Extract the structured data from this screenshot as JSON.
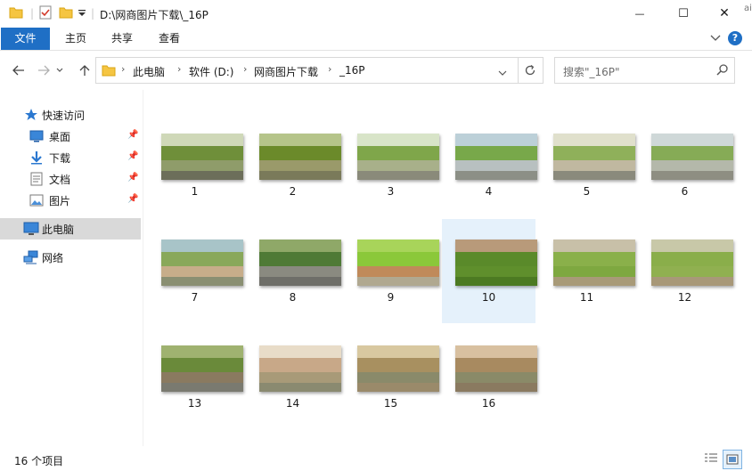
{
  "window": {
    "title": "D:\\网商图片下载\\_16P",
    "controls": {
      "minimize": "—",
      "maximize": "☐",
      "close": "✕"
    },
    "edge_text": "ai"
  },
  "ribbon": {
    "tabs": [
      {
        "label": "文件",
        "active": true
      },
      {
        "label": "主页"
      },
      {
        "label": "共享"
      },
      {
        "label": "查看"
      }
    ]
  },
  "address": {
    "crumbs": [
      "此电脑",
      "软件 (D:)",
      "网商图片下载",
      "_16P"
    ]
  },
  "search": {
    "placeholder": "搜索\"_16P\""
  },
  "sidebar": {
    "quick_access": "快速访问",
    "pinned": [
      {
        "label": "桌面",
        "icon": "desktop-icon"
      },
      {
        "label": "下载",
        "icon": "download-icon"
      },
      {
        "label": "文档",
        "icon": "document-icon"
      },
      {
        "label": "图片",
        "icon": "pictures-icon"
      }
    ],
    "this_pc": "此电脑",
    "network": "网络"
  },
  "files": [
    {
      "name": "1",
      "sky": "#cfd8b8",
      "top": "#6f8f3a",
      "mid": "#8f9c6a",
      "bottom": "#6c6e5a"
    },
    {
      "name": "2",
      "sky": "#b5c48a",
      "top": "#6b8a2a",
      "mid": "#9a9a6a",
      "bottom": "#7a7a5a"
    },
    {
      "name": "3",
      "sky": "#d8e4c8",
      "top": "#7fa64a",
      "mid": "#a8b08a",
      "bottom": "#8a8a7a"
    },
    {
      "name": "4",
      "sky": "#bcd0d8",
      "top": "#78a84a",
      "mid": "#b8c0c0",
      "bottom": "#8c8f86"
    },
    {
      "name": "5",
      "sky": "#e0e0cc",
      "top": "#8fb05a",
      "mid": "#c0b8a0",
      "bottom": "#8a8a7c"
    },
    {
      "name": "6",
      "sky": "#cfd8d8",
      "top": "#86ab56",
      "mid": "#b4b8aa",
      "bottom": "#8e8e82"
    },
    {
      "name": "7",
      "sky": "#a8c4c8",
      "top": "#89a85a",
      "mid": "#c7ad8a",
      "bottom": "#8a8f72"
    },
    {
      "name": "8",
      "sky": "#8fa868",
      "top": "#4f7a36",
      "mid": "#8a8a80",
      "bottom": "#6e6e68"
    },
    {
      "name": "9",
      "sky": "#a8d45a",
      "top": "#8bc83a",
      "mid": "#c08a5a",
      "bottom": "#b0a890"
    },
    {
      "name": "10",
      "sky": "#b89a7a",
      "top": "#5a8a2a",
      "mid": "#5f8f2c",
      "bottom": "#4c7a22"
    },
    {
      "name": "11",
      "sky": "#c8c0a8",
      "top": "#8ab04a",
      "mid": "#7ea840",
      "bottom": "#a89a78"
    },
    {
      "name": "12",
      "sky": "#c8c8a8",
      "top": "#8aae4a",
      "mid": "#90b050",
      "bottom": "#a89878"
    },
    {
      "name": "13",
      "sky": "#9fb270",
      "top": "#6a8a3a",
      "mid": "#8a7a60",
      "bottom": "#7a7a70"
    },
    {
      "name": "14",
      "sky": "#e8dcc8",
      "top": "#c8a888",
      "mid": "#a89a78",
      "bottom": "#8a8a70"
    },
    {
      "name": "15",
      "sky": "#d8c8a0",
      "top": "#a89060",
      "mid": "#8a8a6a",
      "bottom": "#9a8a6a"
    },
    {
      "name": "16",
      "sky": "#d8c0a0",
      "top": "#a88a60",
      "mid": "#8a8a68",
      "bottom": "#8a7a60"
    }
  ],
  "selected_file": "10",
  "status": {
    "count": "16 个项目"
  },
  "colors": {
    "accent": "#1f6fc5",
    "selection": "#e5f1fb",
    "nav_selected": "#d9d9d9",
    "help": "#1f6fc5"
  }
}
